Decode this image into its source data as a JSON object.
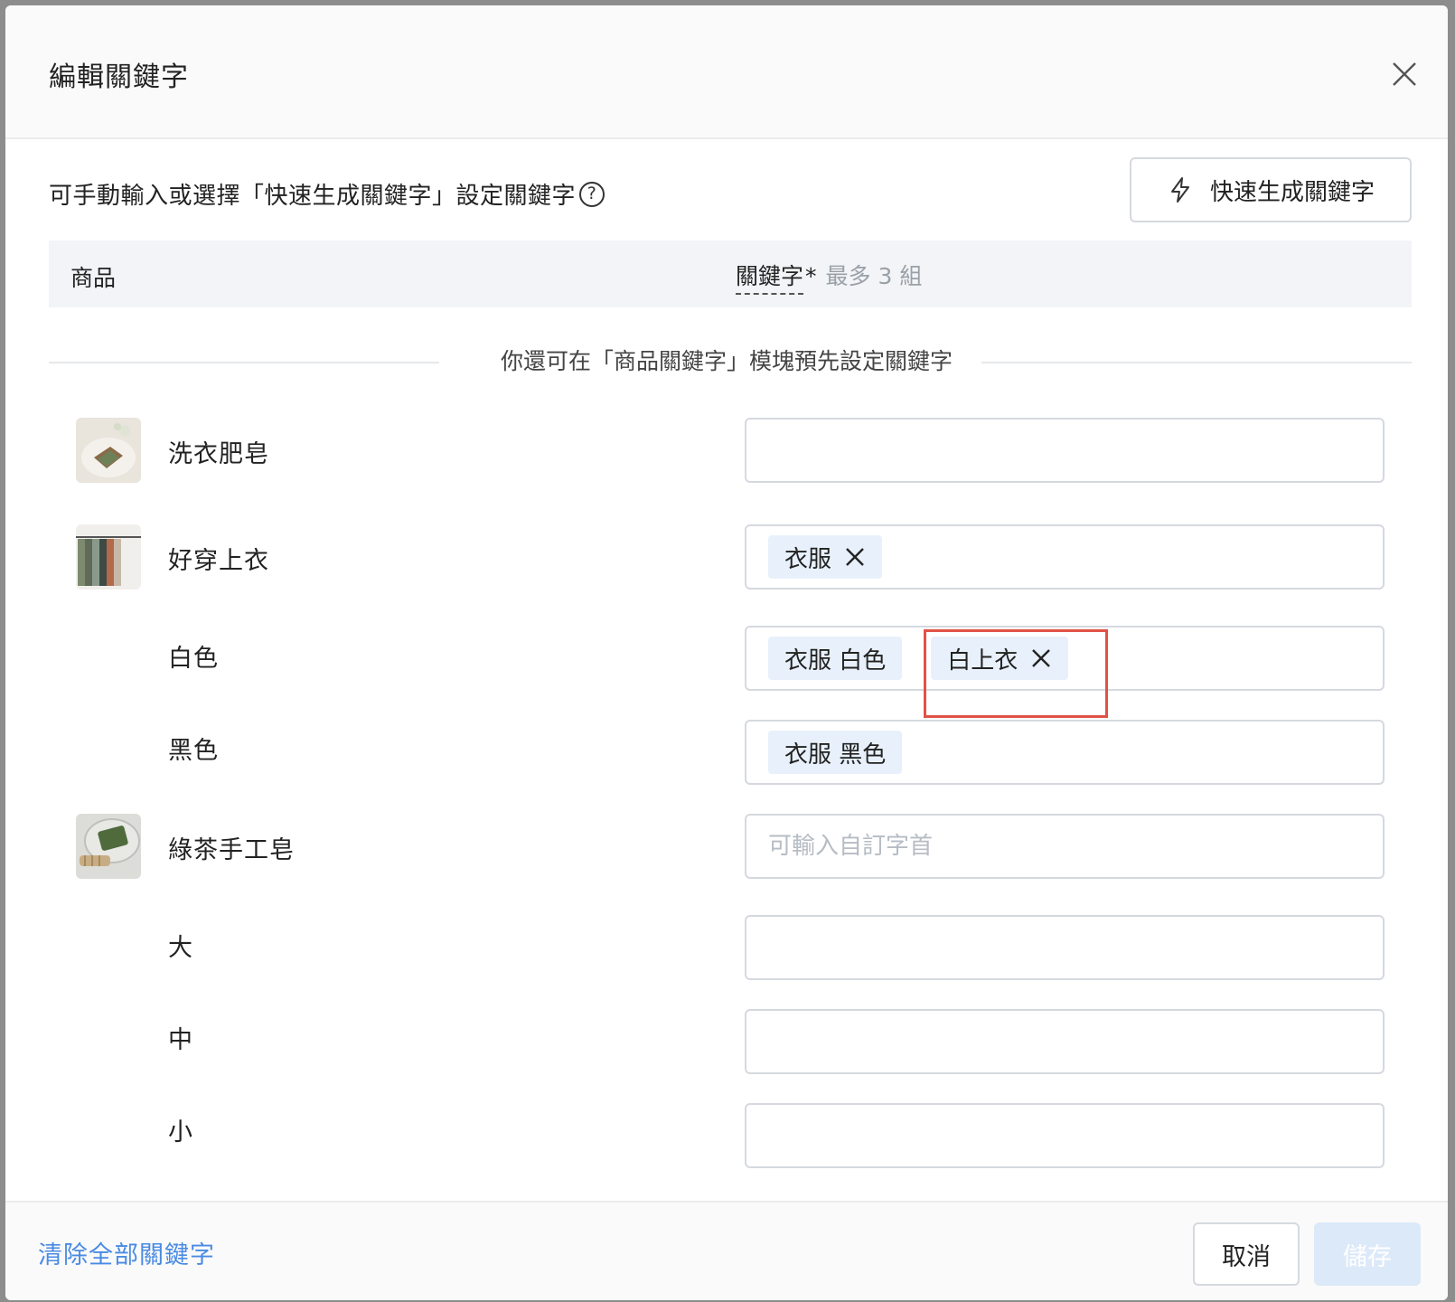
{
  "modal": {
    "title": "編輯關鍵字",
    "hint": "可手動輸入或選擇「快速生成關鍵字」設定關鍵字",
    "quick_generate_label": "快速生成關鍵字"
  },
  "table": {
    "col_product": "商品",
    "col_keyword": "關鍵字",
    "col_keyword_required": "*",
    "col_keyword_max": "最多 3 組",
    "divider_text": "你還可在「商品關鍵字」模塊預先設定關鍵字"
  },
  "rows": [
    {
      "name": "洗衣肥皂",
      "type": "product",
      "tags": [],
      "input_value": "",
      "placeholder": ""
    },
    {
      "name": "好穿上衣",
      "type": "product",
      "tags": [
        {
          "label": "衣服",
          "removable": true
        }
      ],
      "input_value": "",
      "placeholder": ""
    },
    {
      "name": "白色",
      "type": "variant",
      "tags": [
        {
          "label": "衣服 白色",
          "removable": false
        },
        {
          "label": "白上衣",
          "removable": true
        }
      ],
      "input_value": "",
      "placeholder": ""
    },
    {
      "name": "黑色",
      "type": "variant",
      "tags": [
        {
          "label": "衣服 黑色",
          "removable": false
        }
      ],
      "input_value": "",
      "placeholder": ""
    },
    {
      "name": "綠茶手工皂",
      "type": "product",
      "tags": [],
      "input_value": "",
      "placeholder": "可輸入自訂字首"
    },
    {
      "name": "大",
      "type": "variant",
      "tags": [],
      "input_value": "",
      "placeholder": ""
    },
    {
      "name": "中",
      "type": "variant",
      "tags": [],
      "input_value": "",
      "placeholder": ""
    },
    {
      "name": "小",
      "type": "variant",
      "tags": [],
      "input_value": "",
      "placeholder": ""
    }
  ],
  "footer": {
    "clear_all_label": "清除全部關鍵字",
    "cancel_label": "取消",
    "save_label": "儲存"
  },
  "colors": {
    "accent": "#4a8be3",
    "tag_bg": "#e8f1fb",
    "highlight": "#e05246",
    "save_disabled_bg": "#dce9f9"
  },
  "icons": {
    "close": "close-icon",
    "help": "help-circle-icon",
    "lightning": "lightning-icon",
    "tag_remove": "x-icon"
  },
  "help_glyph": "?"
}
